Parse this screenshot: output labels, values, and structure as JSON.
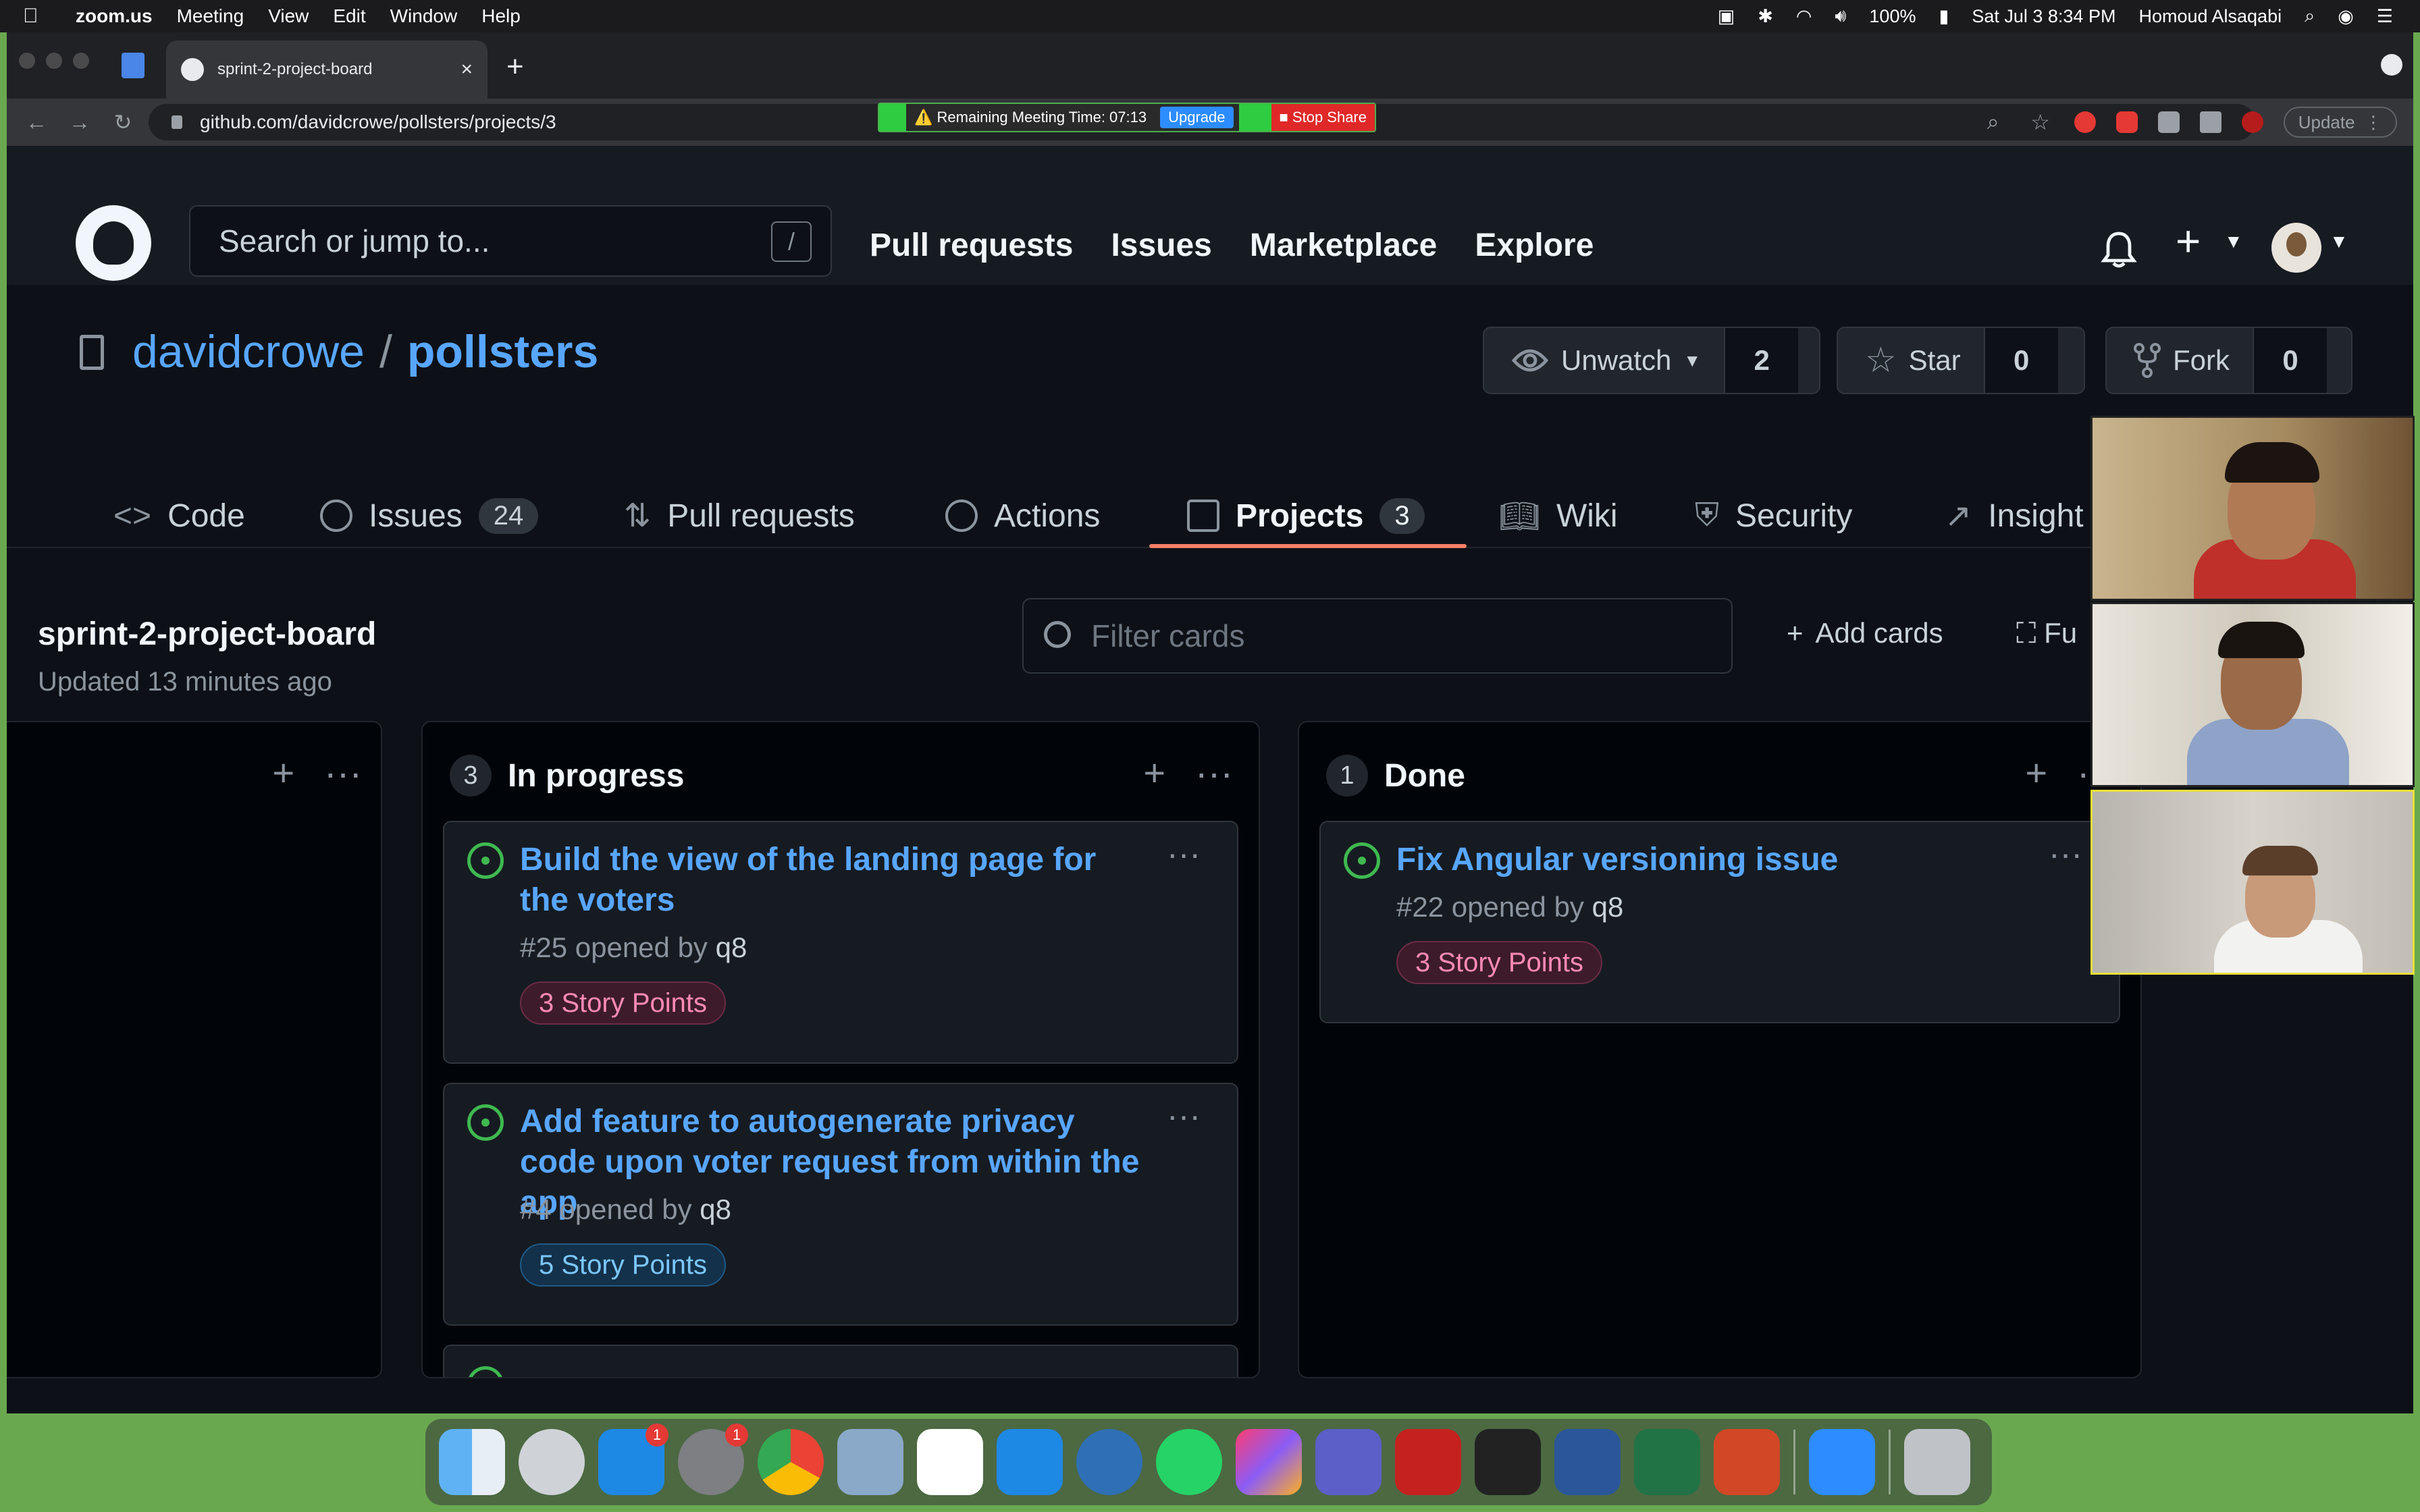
{
  "menubar": {
    "app": "zoom.us",
    "items": [
      "Meeting",
      "View",
      "Edit",
      "Window",
      "Help"
    ],
    "battery": "100%",
    "datetime": "Sat Jul 3  8:34 PM",
    "user": "Homoud Alsaqabi"
  },
  "browser": {
    "tab_title": "sprint-2-project-board",
    "url": "github.com/davidcrowe/pollsters/projects/3",
    "update_label": "Update"
  },
  "zoom_bar": {
    "remaining": "⚠️ Remaining Meeting Time: 07:13",
    "upgrade": "Upgrade",
    "stop_share": "Stop Share"
  },
  "github": {
    "search_placeholder": "Search or jump to...",
    "search_shortcut": "/",
    "nav": [
      "Pull requests",
      "Issues",
      "Marketplace",
      "Explore"
    ]
  },
  "repo": {
    "owner": "davidcrowe",
    "separator": "/",
    "name": "pollsters",
    "watch_label": "Unwatch",
    "watch_count": "2",
    "star_label": "Star",
    "star_count": "0",
    "fork_label": "Fork",
    "fork_count": "0"
  },
  "repo_tabs": {
    "code": "Code",
    "issues": "Issues",
    "issues_count": "24",
    "pulls": "Pull requests",
    "actions": "Actions",
    "projects": "Projects",
    "projects_count": "3",
    "wiki": "Wiki",
    "security": "Security",
    "insights": "Insight"
  },
  "project": {
    "title": "sprint-2-project-board",
    "updated": "Updated 13 minutes ago",
    "filter_placeholder": "Filter cards",
    "add_cards": "Add cards",
    "fullscreen": "Fu"
  },
  "columns": {
    "in_progress": {
      "count": "3",
      "name": "In progress",
      "cards": [
        {
          "title": "Build the view of the landing page for the voters",
          "number": "#25 opened by",
          "user": "q8",
          "label": "3 Story Points"
        },
        {
          "title": "Add feature to autogenerate privacy code upon voter request from within the app",
          "number": "#4 opened by",
          "user": "q8",
          "label": "5 Story Points"
        }
      ]
    },
    "done": {
      "count": "1",
      "name": "Done",
      "cards": [
        {
          "title": "Fix Angular versioning issue",
          "number": "#22 opened by",
          "user": "q8",
          "label": "3 Story Points"
        }
      ]
    }
  },
  "dock": {
    "badges": {
      "app_store": "1",
      "system_prefs": "1"
    }
  },
  "colors": {
    "gh_bg": "#0d1117",
    "gh_header": "#161b22",
    "link": "#58a6ff",
    "open_issue": "#3fb950",
    "tab_underline": "#f78166",
    "zoom_frame": "#6aa84f"
  }
}
